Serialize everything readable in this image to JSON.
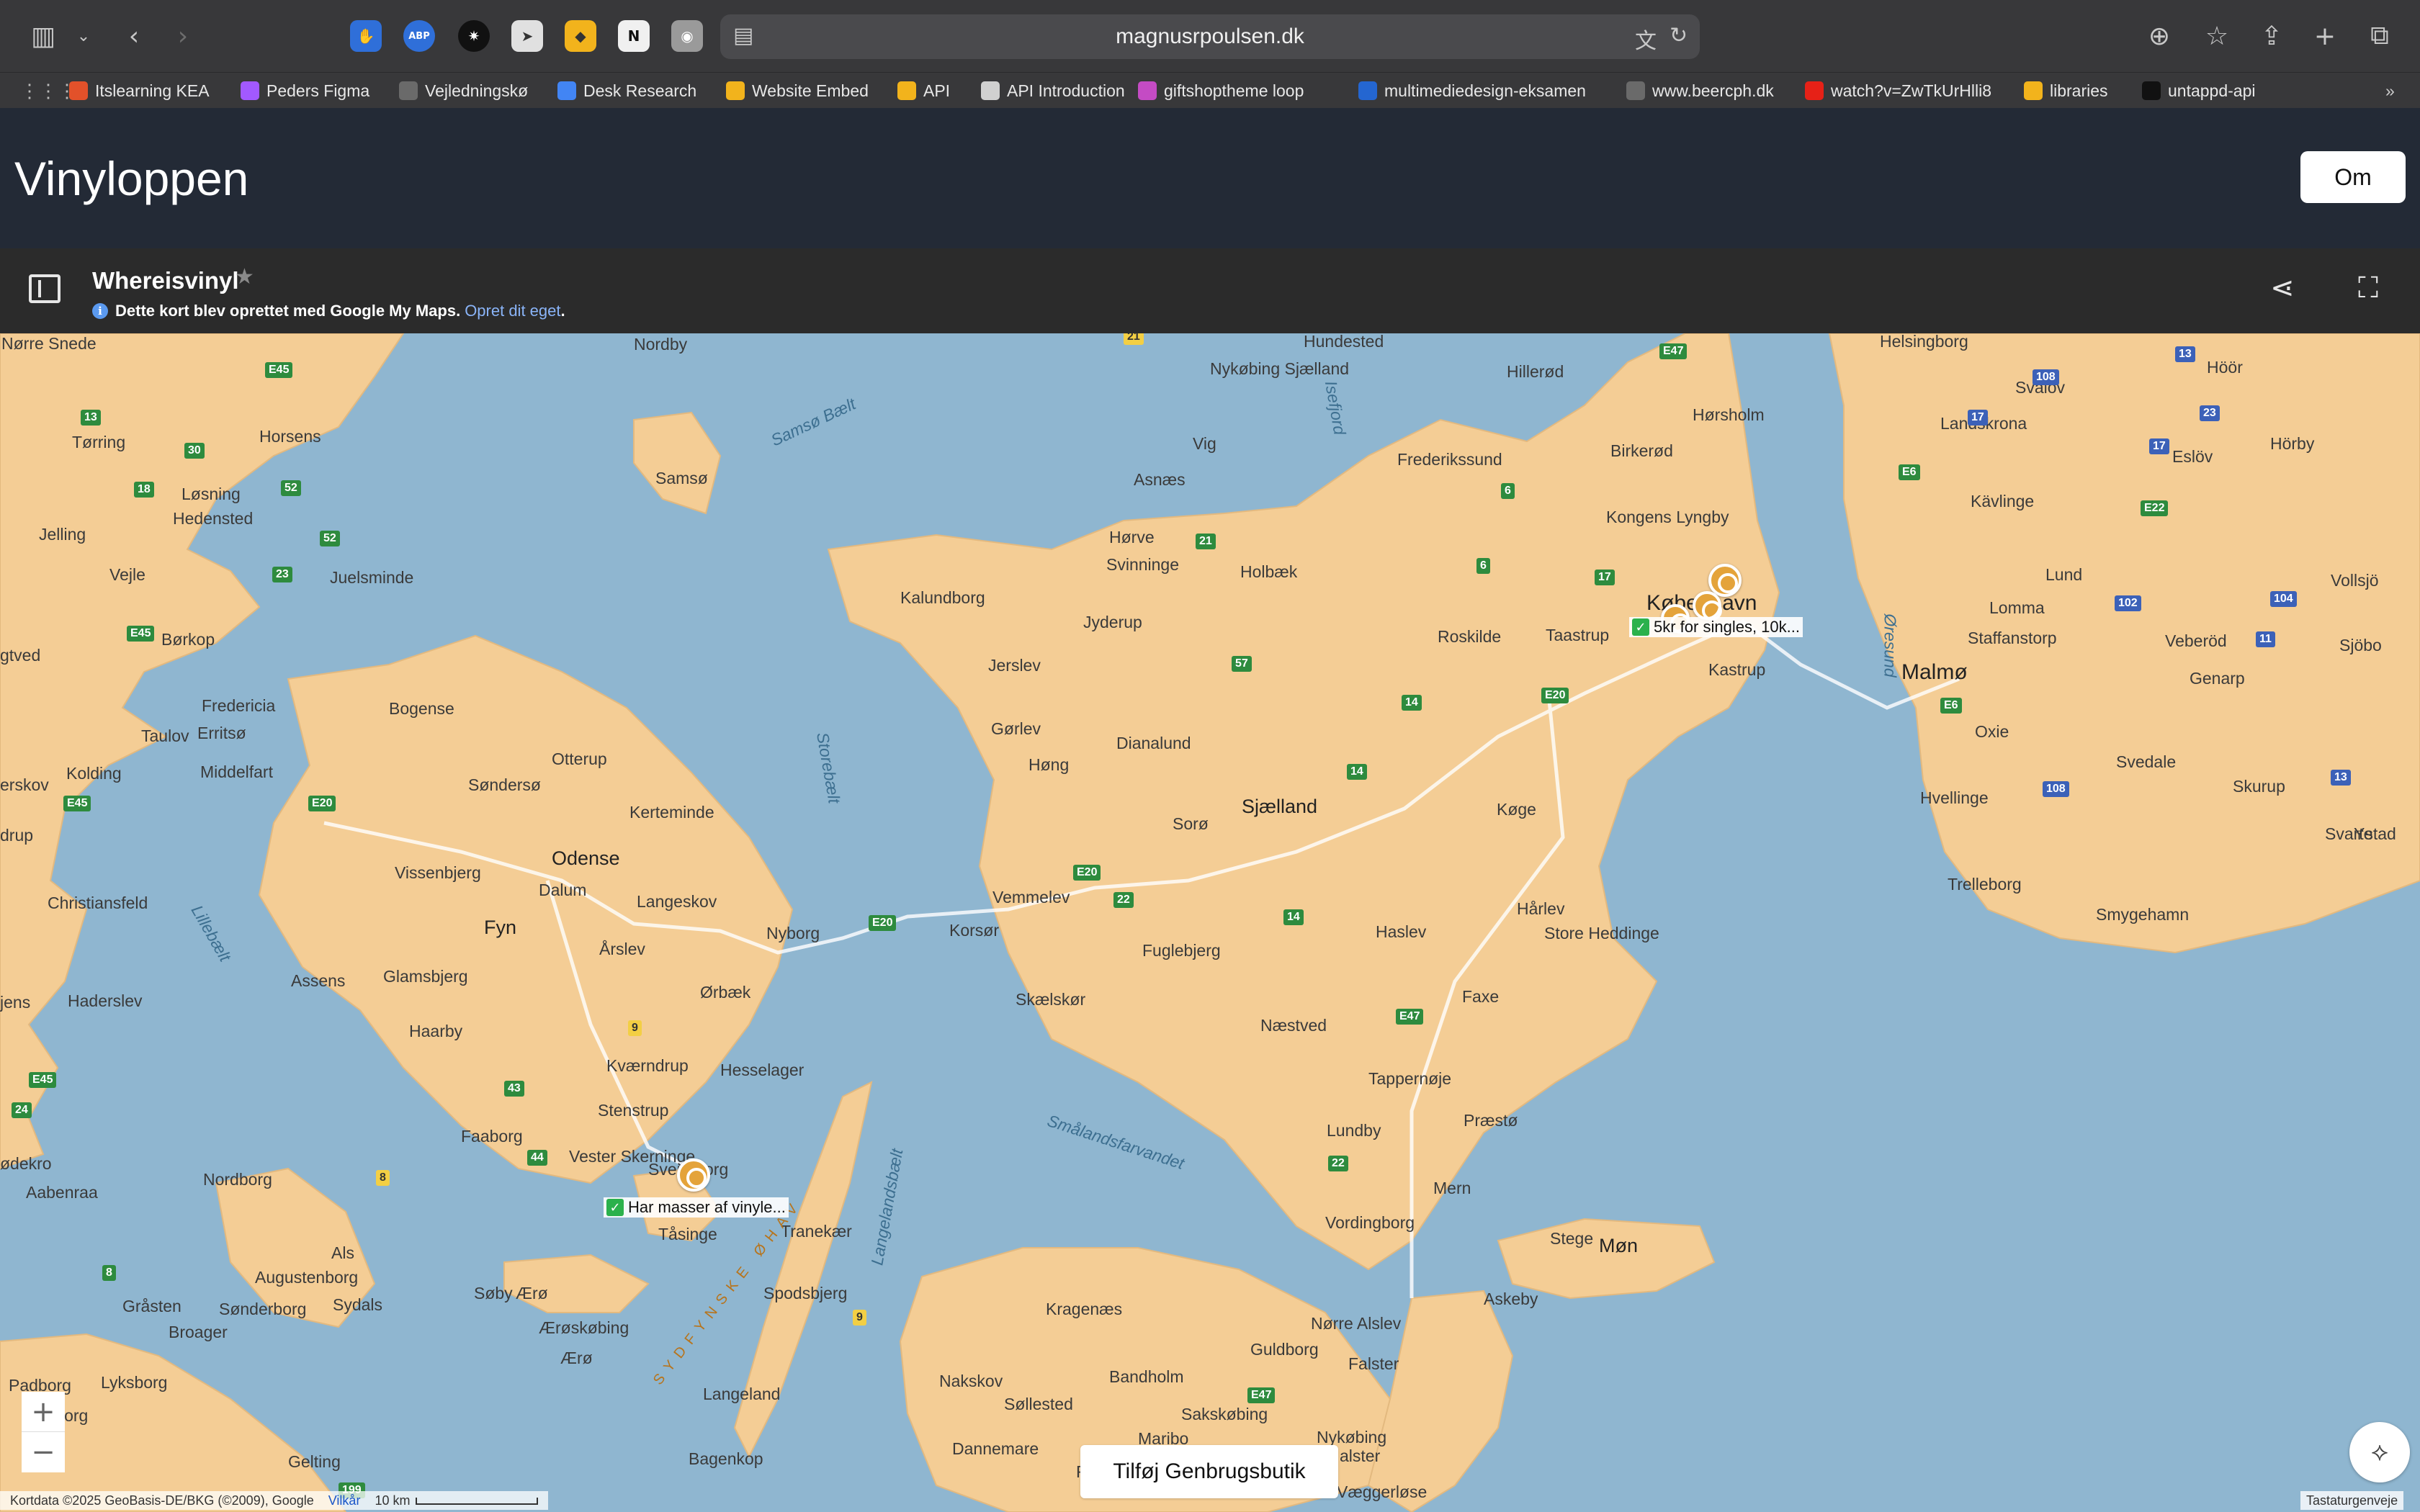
{
  "browser": {
    "url": "magnusrpoulsen.dk",
    "bookmarks": [
      {
        "label": "Itslearning KEA",
        "icon": "itslearning-icon",
        "color": "#e2512a"
      },
      {
        "label": "Peders Figma",
        "icon": "figma-icon",
        "color": "#a259ff"
      },
      {
        "label": "Vejledningskø",
        "icon": "globe-icon",
        "color": "#6a6a6a"
      },
      {
        "label": "Desk Research",
        "icon": "docs-icon",
        "color": "#4285f4"
      },
      {
        "label": "Website Embed",
        "icon": "ai-icon",
        "color": "#f2b31c"
      },
      {
        "label": "API",
        "icon": "ai-icon",
        "color": "#f2b31c"
      },
      {
        "label": "API Introduction",
        "icon": "doc-icon",
        "color": "#d0d0d0"
      },
      {
        "label": "giftshoptheme loop",
        "icon": "loop-icon",
        "color": "#c44bc4"
      },
      {
        "label": "multimediedesign-eksamen",
        "icon": "trello-icon",
        "color": "#2466d1"
      },
      {
        "label": "www.beercph.dk",
        "icon": "globe-icon",
        "color": "#6a6a6a"
      },
      {
        "label": "watch?v=ZwTkUrHlli8",
        "icon": "youtube-icon",
        "color": "#e62117"
      },
      {
        "label": "libraries",
        "icon": "ai-icon",
        "color": "#f2b31c"
      },
      {
        "label": "untappd-api",
        "icon": "code-icon",
        "color": "#111111"
      }
    ]
  },
  "app": {
    "title": "Vinyloppen",
    "about_button": "Om"
  },
  "mymap": {
    "title": "Whereisvinyl",
    "note": "Dette kort blev oprettet med Google My Maps.",
    "note_link": "Opret dit eget"
  },
  "map": {
    "places": {
      "nskov": "Nørre Snede",
      "nordby": "Nordby",
      "hundested": "Hundested",
      "nykobing_sj": "Nykøbing Sjælland",
      "hillerod": "Hillerød",
      "helsingborg": "Helsingborg",
      "svalov": "Svalöv",
      "hoor": "Höör",
      "torring": "Tørring",
      "horsens": "Horsens",
      "samso": "Samsø",
      "vig": "Vig",
      "frederikssund": "Frederikssund",
      "horsholm": "Hørsholm",
      "landskrona": "Landskrona",
      "eslov": "Eslöv",
      "horby": "Hörby",
      "birkerod": "Birkerød",
      "losning": "Løsning",
      "hedensted": "Hedensted",
      "asnaes": "Asnæs",
      "jelling": "Jelling",
      "kongens_lyngby": "Kongens Lyngby",
      "kavlinge": "Kävlinge",
      "horve": "Hørve",
      "svinninge": "Svinninge",
      "holbaek": "Holbæk",
      "vejle": "Vejle",
      "juelsminde": "Juelsminde",
      "lund": "Lund",
      "vollsjo": "Vollsjö",
      "kalundborg": "Kalundborg",
      "kobenhavn": "København",
      "borkop": "Børkop",
      "jyderup": "Jyderup",
      "roskilde": "Roskilde",
      "taastrup": "Taastrup",
      "lomma": "Lomma",
      "staffanstorp": "Staffanstorp",
      "veberod": "Veberöd",
      "sjobo": "Sjöbo",
      "gtved": "gtved",
      "jerslev": "Jerslev",
      "kastrup": "Kastrup",
      "malmo": "Malmø",
      "fredericia": "Fredericia",
      "bogense": "Bogense",
      "genarp": "Genarp",
      "taulov": "Taulov",
      "erritso": "Erritsø",
      "gorlev": "Gørlev",
      "oxie": "Oxie",
      "otterup": "Otterup",
      "hong": "Høng",
      "dianalund": "Dianalund",
      "middelfart": "Middelfart",
      "svedale": "Svedale",
      "kolding": "Kolding",
      "sondersio": "Søndersø",
      "skurup": "Skurup",
      "erskov": "erskov",
      "kerteminde": "Kerteminde",
      "sjaelland": "Sjælland",
      "hvellinge": "Hvellinge",
      "koge": "Køge",
      "soro": "Sorø",
      "drup": "drup",
      "odense": "Odense",
      "svarte": "Svarte",
      "ystad": "Ystad",
      "dalum": "Dalum",
      "christiansfeld": "Christiansfeld",
      "langeskov": "Langeskov",
      "vissenbjerg": "Vissenbjerg",
      "vemmelev": "Vemmelev",
      "harlev": "Hårlev",
      "trelleborg": "Trelleborg",
      "smygehamn": "Smygehamn",
      "fyn": "Fyn",
      "nyborg": "Nyborg",
      "korsor": "Korsør",
      "fuglebjerg": "Fuglebjerg",
      "haslev": "Haslev",
      "store_heddinge": "Store Heddinge",
      "arslev": "Årslev",
      "assens": "Assens",
      "glamsbjerg": "Glamsbjerg",
      "skaelskor": "Skælskør",
      "faxe": "Faxe",
      "jens": "jens",
      "haderslev": "Haderslev",
      "orbaek": "Ørbæk",
      "naestved": "Næstved",
      "haarby": "Haarby",
      "kvaerndrup": "Kværndrup",
      "hesselager": "Hesselager",
      "tappernoje": "Tappernøje",
      "praesto": "Præstø",
      "stenstrup": "Stenstrup",
      "faaborg": "Faaborg",
      "lundby": "Lundby",
      "vester_skerninge": "Vester Skerninge",
      "svendborg": "Svendborg",
      "odekro": "ødekro",
      "aabenraa": "Aabenraa",
      "nordborg": "Nordborg",
      "mern": "Mern",
      "tasinge": "Tåsinge",
      "tranekaer": "Tranekær",
      "vordingborg": "Vordingborg",
      "stege": "Stege",
      "mon": "Møn",
      "als": "Als",
      "augustenborg": "Augustenborg",
      "soby": "Søby",
      "aero_n": "Ærø",
      "spodsbjerg": "Spodsbjerg",
      "askeby": "Askeby",
      "grasten": "Gråsten",
      "sonderborg": "Sønderborg",
      "sydals": "Sydals",
      "kragenaes": "Kragenæs",
      "aeroskobing": "Ærøskøbing",
      "norre_alslev": "Nørre Alslev",
      "broager": "Broager",
      "guldborg": "Guldborg",
      "aero": "Ærø",
      "falster": "Falster",
      "lyksborg": "Lyksborg",
      "nakskov": "Nakskov",
      "bandholm": "Bandholm",
      "langeland": "Langeland",
      "sollested": "Søllested",
      "sakskobing": "Sakskøbing",
      "padborg": "Padborg",
      "flensborg": "nsborg",
      "maribo": "Maribo",
      "nykobing_f": "Nykøbing",
      "alster": "alster",
      "dannemare": "Dannemare",
      "bagenkop": "Bagenkop",
      "gelting": "Gelting",
      "rodby": "Rødby",
      "vaeggerlose": "Væggerløse",
      "sydfynske": "SYDFYNSKE ØHAV"
    },
    "water": {
      "samso_baelt": "Samsø Bælt",
      "isefjord": "Isefjord",
      "oresund": "Øresund",
      "storebaelt": "Storebælt",
      "lillebaelt": "Lillebælt",
      "smalandsfarvandet": "Smålandsfarvandet",
      "langelandsbaelt": "Langelandsbælt"
    },
    "roads": {
      "e45a": "E45",
      "e47a": "E47",
      "r21a": "21",
      "r13": "13",
      "r30": "30",
      "r18": "18",
      "r52a": "52",
      "r52b": "52",
      "r23": "23",
      "e45b": "E45",
      "r21b": "21",
      "r6a": "6",
      "r17": "17",
      "r57": "57",
      "r6b": "6",
      "e20a": "E20",
      "r14a": "14",
      "r14b": "14",
      "e45c": "E45",
      "e20b": "E20",
      "e20c": "E20",
      "r22a": "22",
      "r14c": "14",
      "e20d": "E20",
      "e47b": "E47",
      "r9a": "9",
      "r43": "43",
      "r44": "44",
      "r8a": "8",
      "r22b": "22",
      "r24": "24",
      "e45d": "E45",
      "r8b": "8",
      "r9b": "9",
      "e47c": "E47",
      "r199": "199",
      "s108a": "108",
      "s13a": "13",
      "s17a": "17",
      "s17b": "17",
      "s23": "23",
      "e6a": "E6",
      "e22": "E22",
      "r102": "102",
      "r104": "104",
      "r11": "11",
      "e6b": "E6",
      "s108b": "108",
      "s13b": "13"
    },
    "pins": [
      {
        "label": "5kr for singles, 10k..."
      },
      {
        "label": "Har masser af vinyle..."
      }
    ],
    "add_button": "Tilføj Genbrugsbutik",
    "attribution": "Kortdata ©2025 GeoBasis-DE/BKG (©2009), Google",
    "terms": "Vilkår",
    "scale": "10 km",
    "keyboard": "Tastaturgenveje",
    "colors": {
      "water": "#8fb6d0",
      "land": "#f4cd95",
      "pin": "#e4a33a"
    }
  }
}
